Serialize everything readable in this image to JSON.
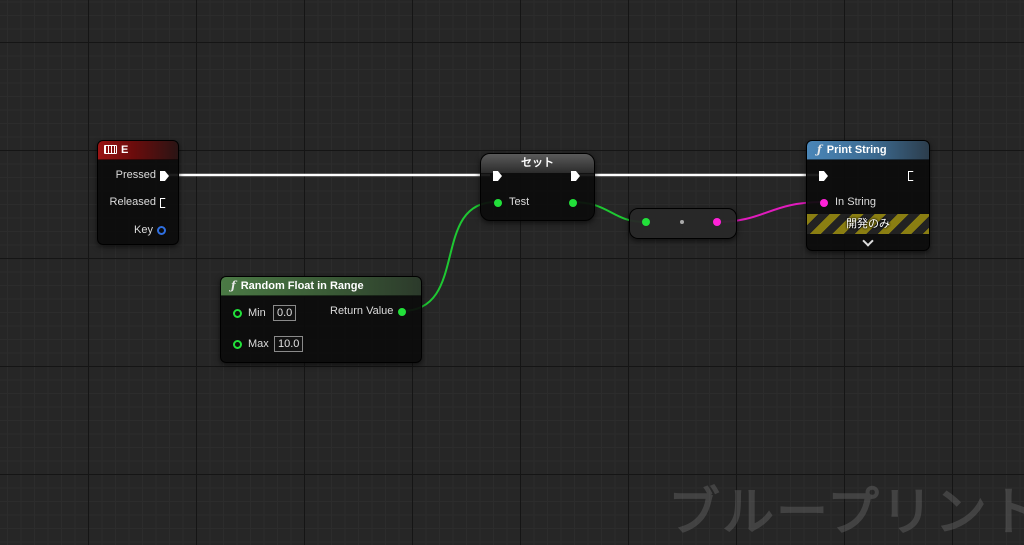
{
  "event_node": {
    "title": "E",
    "pins": [
      "Pressed",
      "Released",
      "Key"
    ]
  },
  "set_node": {
    "title": "セット",
    "input_label": "Test"
  },
  "random_node": {
    "title": "Random Float in Range",
    "min_label": "Min",
    "min_value": "0.0",
    "max_label": "Max",
    "max_value": "10.0",
    "return_label": "Return Value"
  },
  "print_node": {
    "title": "Print String",
    "input_label": "In String",
    "dev_only": "開発のみ"
  },
  "watermark": "ブループリント",
  "colors": {
    "exec": "#ffffff",
    "float": "#22e03a",
    "string": "#ff22d8",
    "struct_key": "#2f6fe0",
    "event_header": "#9a1414",
    "function_header_green": "#4b7a45",
    "function_header_blue": "#4a86b8"
  },
  "icons": [
    "keyboard-icon",
    "function-icon",
    "exec-pin",
    "float-pin",
    "string-pin",
    "chevron-down-icon"
  ]
}
